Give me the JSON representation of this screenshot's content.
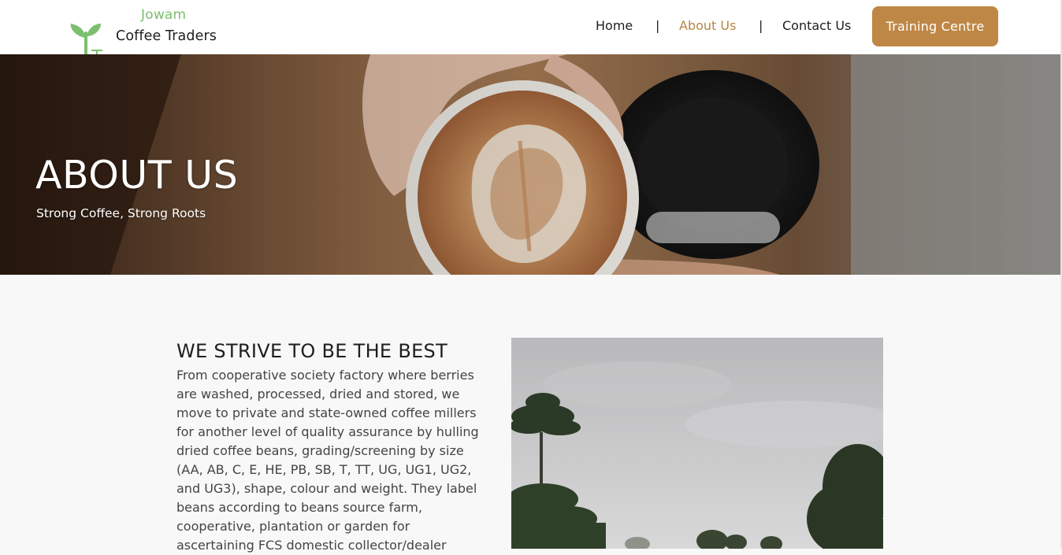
{
  "header": {
    "brand_top": "Jowam",
    "brand_bottom": "Coffee Traders",
    "nav": {
      "home": "Home",
      "about": "About Us",
      "contact": "Contact Us",
      "separator": "|"
    },
    "cta_label": "Training Centre"
  },
  "hero": {
    "title": "ABOUT US",
    "subtitle": "Strong Coffee, Strong Roots"
  },
  "content": {
    "heading": "WE STRIVE TO BE THE BEST",
    "body": "From cooperative society factory where berries are washed, processed, dried and stored, we move to private and state-owned coffee millers for another level of quality assurance by hulling dried coffee beans, grading/screening by size (AA, AB, C, E, HE, PB, SB, T, TT, UG, UG1, UG2, and UG3), shape, colour and weight. They label beans according to beans source farm, cooperative, plantation or garden for ascertaining FCS domestic collector/dealer"
  },
  "colors": {
    "accent": "#bf8745",
    "active_link": "#b98445",
    "brand_green": "#7cbf6e"
  },
  "icons": {
    "logo": "coffee-plant-logo"
  }
}
